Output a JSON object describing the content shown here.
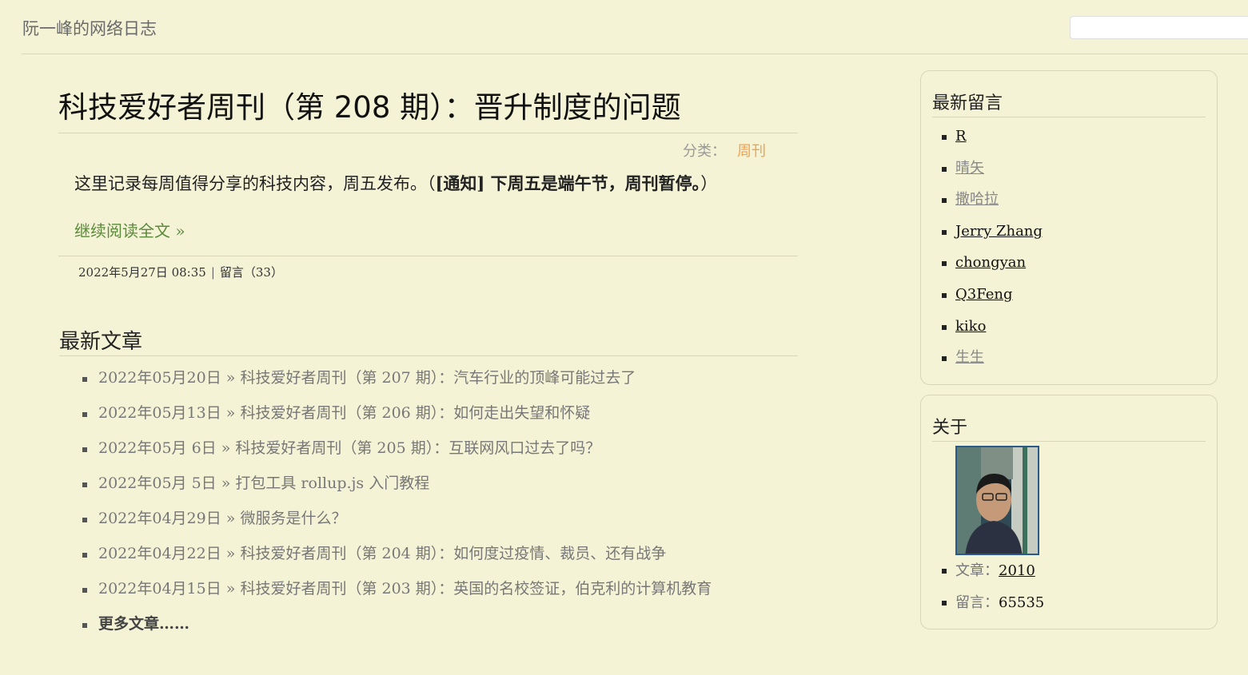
{
  "header": {
    "site_title": "阮一峰的网络日志"
  },
  "article": {
    "title": "科技爱好者周刊（第 208 期）：晋升制度的问题",
    "category_label": "分类：",
    "category": "周刊",
    "summary_plain": "这里记录每周值得分享的科技内容，周五发布。（",
    "summary_bold": "[通知] 下周五是端午节，周刊暂停。",
    "summary_end": "）",
    "read_more": "继续阅读全文 »",
    "date": "2022年5月27日 08:35",
    "separator": "|",
    "comments": "留言（33）"
  },
  "recent": {
    "title": "最新文章",
    "items": [
      {
        "date": "2022年05月20日",
        "sep": "»",
        "title": "科技爱好者周刊（第 207 期）：汽车行业的顶峰可能过去了"
      },
      {
        "date": "2022年05月13日",
        "sep": "»",
        "title": "科技爱好者周刊（第 206 期）：如何走出失望和怀疑"
      },
      {
        "date": "2022年05月 6日",
        "sep": "»",
        "title": "科技爱好者周刊（第 205 期）：互联网风口过去了吗？"
      },
      {
        "date": "2022年05月 5日",
        "sep": "»",
        "title": "打包工具 rollup.js 入门教程"
      },
      {
        "date": "2022年04月29日",
        "sep": "»",
        "title": "微服务是什么？"
      },
      {
        "date": "2022年04月22日",
        "sep": "»",
        "title": "科技爱好者周刊（第 204 期）：如何度过疫情、裁员、还有战争"
      },
      {
        "date": "2022年04月15日",
        "sep": "»",
        "title": "科技爱好者周刊（第 203 期）：英国的名校签证，伯克利的计算机教育"
      }
    ],
    "more": "更多文章……"
  },
  "sidebar": {
    "comments_title": "最新留言",
    "commenters": [
      "R",
      "晴矢",
      "撒哈拉",
      "Jerry Zhang",
      "chongyan",
      "Q3Feng",
      "kiko",
      "生生"
    ],
    "about_title": "关于",
    "articles_label": "文章：",
    "articles_count": "2010",
    "comments_label": "留言：",
    "comments_count": "65535"
  }
}
